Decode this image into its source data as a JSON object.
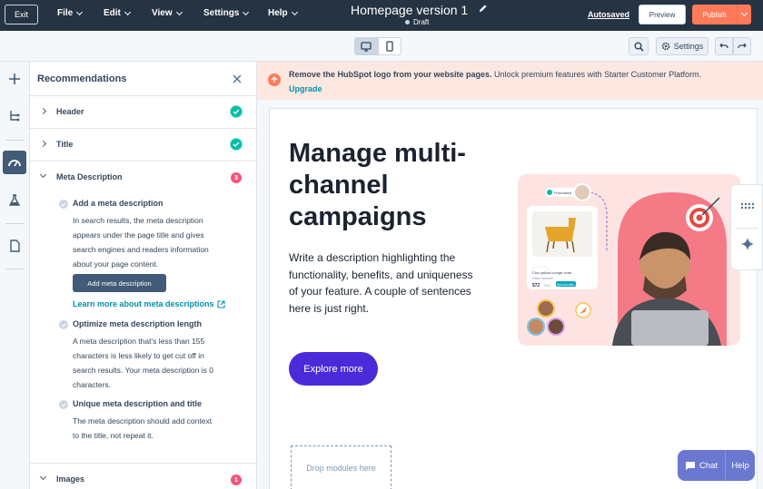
{
  "topbar": {
    "exit_label": "Exit",
    "menus": [
      "File",
      "Edit",
      "View",
      "Settings",
      "Help"
    ],
    "page_title": "Homepage version 1",
    "status": "Draft",
    "autosaved": "Autosaved",
    "preview_label": "Preview",
    "publish_label": "Publish"
  },
  "toolbar": {
    "settings_label": "Settings"
  },
  "panel": {
    "title": "Recommendations",
    "sections": [
      {
        "label": "Header",
        "state": "complete"
      },
      {
        "label": "Title",
        "state": "complete"
      },
      {
        "label": "Meta Description",
        "state": "open",
        "count": "3"
      },
      {
        "label": "Images",
        "count": "1"
      }
    ],
    "meta": {
      "items": [
        {
          "title": "Add a meta description",
          "lines": [
            "In search results, the meta description",
            "appears under the page title and gives",
            "search engines and readers information",
            "about your page content."
          ]
        },
        {
          "title": "Optimize meta description length",
          "lines": [
            "A meta description that's less than 155",
            "characters is less likely to get cut off in",
            "search results. Your meta description is 0",
            "characters."
          ]
        },
        {
          "title": "Unique meta description and title",
          "lines": [
            "The meta description should add context",
            "to the title, not repeat it."
          ]
        }
      ],
      "add_button": "Add meta description",
      "learn_more": "Learn more about meta descriptions"
    }
  },
  "banner": {
    "bold": "Remove the HubSpot logo from your website pages.",
    "text": " Unlock premium features with Starter Customer Platform. ",
    "link": "Upgrade"
  },
  "page": {
    "hero_title": "Manage multi-channel campaigns",
    "hero_desc": "Write a description highlighting the functionality, benefits, and uniqueness of your feature. A couple of sentences here is just right.",
    "cta": "Explore more",
    "dropzone": "Drop modules here",
    "product_card": {
      "name": "Chic yellow lounge chair",
      "category": "Office furniture",
      "price": "$72",
      "old_price": "$98",
      "tag": "Special offer",
      "badge": "Purchased"
    }
  },
  "chat": {
    "chat_label": "Chat",
    "help_label": "Help"
  },
  "colors": {
    "topbar": "#253342",
    "publish": "#ff7a59",
    "cta": "#4b2ad9",
    "success": "#00bda5",
    "alert": "#f2547d",
    "link": "#0091ae"
  }
}
